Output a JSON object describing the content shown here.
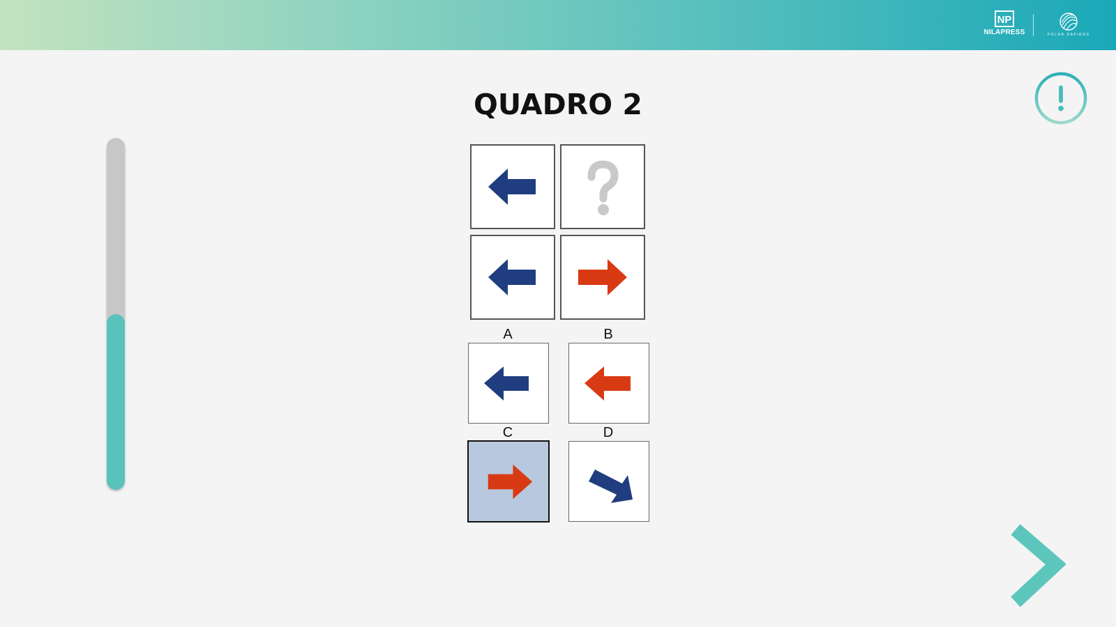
{
  "header": {
    "logo_left_text": "NILAPRESS",
    "logo_left_mark": "NP",
    "logo_right_text": "POLAR SAPIENS"
  },
  "progress": {
    "fraction": 0.5,
    "color": "#59c2bb"
  },
  "title": "QUADRO 2",
  "grid": [
    {
      "icon": "arrow-left-icon",
      "color": "#203d80"
    },
    {
      "icon": "question-mark-icon",
      "color": "#c9c9c9"
    },
    {
      "icon": "arrow-left-icon",
      "color": "#203d80"
    },
    {
      "icon": "arrow-right-icon",
      "color": "#d83a14"
    }
  ],
  "options": [
    {
      "label": "A",
      "icon": "arrow-left-icon",
      "color": "#203d80",
      "selected": false
    },
    {
      "label": "B",
      "icon": "arrow-left-icon",
      "color": "#d83a14",
      "selected": false
    },
    {
      "label": "C",
      "icon": "arrow-right-icon",
      "color": "#d83a14",
      "selected": true
    },
    {
      "label": "D",
      "icon": "arrow-down-right-icon",
      "color": "#203d80",
      "selected": false
    }
  ],
  "controls": {
    "alert_icon": "exclamation-circle-icon",
    "next_icon": "chevron-right-icon",
    "accent": "#5cc6bd"
  }
}
